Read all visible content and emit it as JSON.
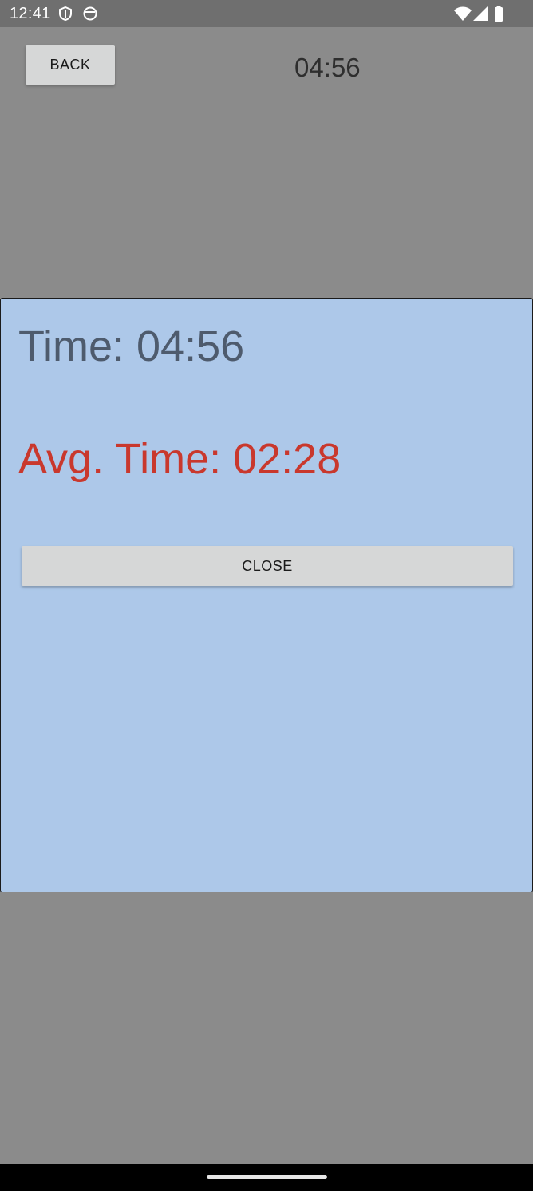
{
  "status_bar": {
    "time": "12:41",
    "left_icons": [
      "shield-icon",
      "face-icon"
    ],
    "right_icons": [
      "wifi-icon",
      "signal-icon",
      "battery-icon"
    ]
  },
  "header": {
    "back_label": "BACK",
    "timer": "04:56"
  },
  "dialog": {
    "time_text": "Time: 04:56",
    "avg_time_text": "Avg. Time: 02:28",
    "close_label": "CLOSE"
  },
  "colors": {
    "background": "#8b8b8b",
    "dialog_background": "#adc8e9",
    "time_text": "#4e5b6d",
    "avg_time_text": "#c9382d",
    "button": "#d6d7d7"
  }
}
